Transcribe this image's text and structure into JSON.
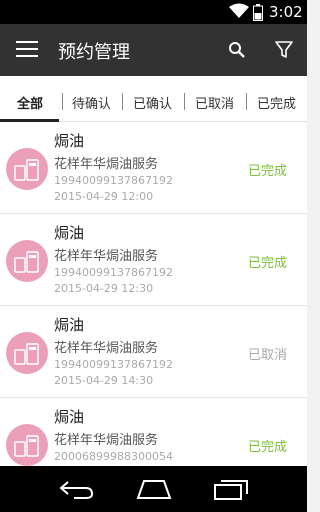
{
  "statusbar": {
    "time": "3:02"
  },
  "appbar": {
    "title": "预约管理"
  },
  "tabs": [
    {
      "label": "全部",
      "active": true
    },
    {
      "label": "待确认"
    },
    {
      "label": "已确认"
    },
    {
      "label": "已取消"
    },
    {
      "label": "已完成"
    }
  ],
  "orders": [
    {
      "name": "焗油",
      "service": "花样年华焗油服务",
      "order_no": "19940099137867192",
      "datetime": "2015-04-29 12:00",
      "status": "已完成"
    },
    {
      "name": "焗油",
      "service": "花样年华焗油服务",
      "order_no": "19940099137867192",
      "datetime": "2015-04-29 12:30",
      "status": "已完成"
    },
    {
      "name": "焗油",
      "service": "花样年华焗油服务",
      "order_no": "19940099137867192",
      "datetime": "2015-04-29 14:30",
      "status": "已取消"
    },
    {
      "name": "焗油",
      "service": "花样年华焗油服务",
      "order_no": "20006899988300054",
      "datetime": "",
      "status": "已完成"
    }
  ],
  "colors": {
    "appbar": "#323232",
    "avatar": "#ec9fb8",
    "done": "#7bbf3a",
    "cancel": "#aaaaaa"
  },
  "icons": [
    "wifi-icon",
    "battery-icon",
    "menu-icon",
    "search-icon",
    "filter-icon",
    "back-icon",
    "home-icon",
    "recents-icon"
  ]
}
